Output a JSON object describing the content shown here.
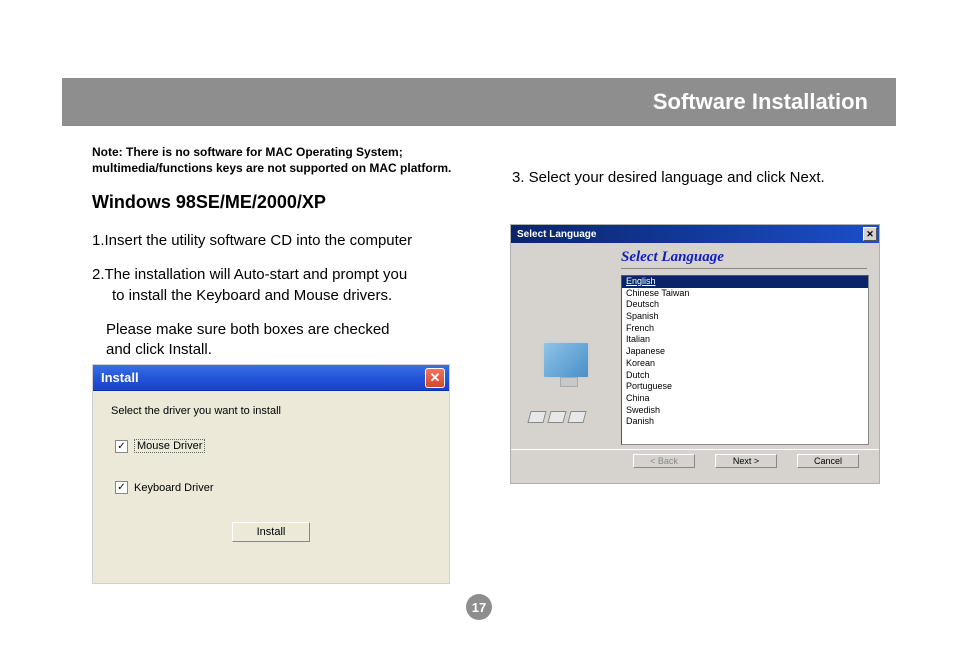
{
  "header": {
    "title": "Software Installation"
  },
  "note": {
    "line1": "Note: There is no software for MAC Operating System;",
    "line2": "multimedia/functions keys are not supported on MAC platform."
  },
  "section_heading": "Windows 98SE/ME/2000/XP",
  "steps": {
    "s1": "1.Insert the utility software CD into the computer",
    "s2a": "2.The installation will Auto-start and prompt you",
    "s2b": "to install the Keyboard and Mouse drivers.",
    "s2c": "Please make sure both boxes are checked",
    "s2d": "and click Install.",
    "s3": "3. Select your desired language and click Next."
  },
  "install_dialog": {
    "title": "Install",
    "close": "✕",
    "prompt": "Select  the driver you want to install",
    "opt1": "Mouse Driver",
    "opt2": "Keyboard Driver",
    "button": "Install",
    "check": "✓"
  },
  "lang_dialog": {
    "titlebar": "Select Language",
    "close": "✕",
    "heading": "Select Language",
    "languages": [
      "English",
      "Chinese Taiwan",
      "Deutsch",
      "Spanish",
      "French",
      "Italian",
      "Japanese",
      "Korean",
      "Dutch",
      "Portuguese",
      "China",
      "Swedish",
      "Danish"
    ],
    "back": "< Back",
    "next": "Next >",
    "cancel": "Cancel"
  },
  "page_number": "17"
}
